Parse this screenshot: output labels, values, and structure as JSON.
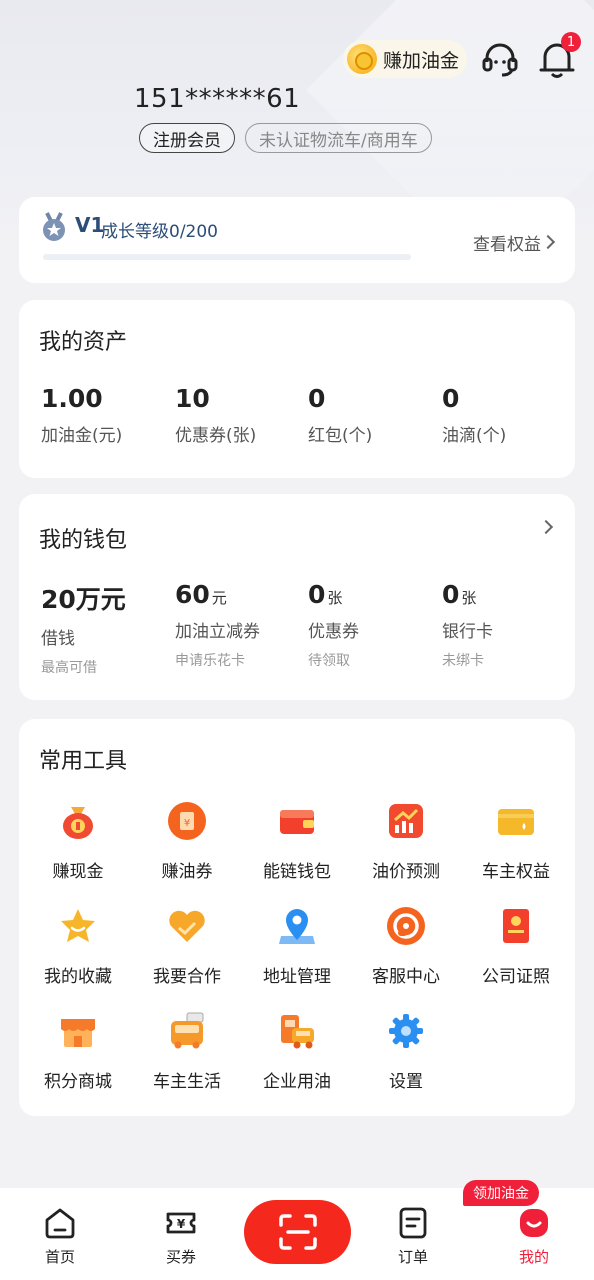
{
  "header": {
    "earn_label": "赚加油金",
    "bell_badge": "1",
    "phone": "151******61",
    "tag_member": "注册会员",
    "tag_vehicle": "未认证物流车/商用车"
  },
  "level": {
    "tier": "V1",
    "progress_text": "成长等级0/200",
    "progress_fraction": 0,
    "view_rights": "查看权益"
  },
  "assets": {
    "title": "我的资产",
    "items": [
      {
        "value": "1.00",
        "label": "加油金(元)"
      },
      {
        "value": "10",
        "label": "优惠券(张)"
      },
      {
        "value": "0",
        "label": "红包(个)"
      },
      {
        "value": "0",
        "label": "油滴(个)"
      }
    ]
  },
  "wallet": {
    "title": "我的钱包",
    "items": [
      {
        "value": "20万元",
        "unit": "",
        "label": "借钱",
        "sub": "最高可借"
      },
      {
        "value": "60",
        "unit": "元",
        "label": "加油立减券",
        "sub": "申请乐花卡"
      },
      {
        "value": "0",
        "unit": "张",
        "label": "优惠券",
        "sub": "待领取"
      },
      {
        "value": "0",
        "unit": "张",
        "label": "银行卡",
        "sub": "未绑卡"
      }
    ]
  },
  "tools": {
    "title": "常用工具",
    "items": [
      {
        "label": "赚现金",
        "icon": "money-bag-icon",
        "color": "#f04a32"
      },
      {
        "label": "赚油券",
        "icon": "coupon-icon",
        "color": "#f5641e"
      },
      {
        "label": "能链钱包",
        "icon": "wallet-icon",
        "color": "#f2402c"
      },
      {
        "label": "油价预测",
        "icon": "chart-icon",
        "color": "#f24a2e"
      },
      {
        "label": "车主权益",
        "icon": "card-icon",
        "color": "#f5b82a"
      },
      {
        "label": "我的收藏",
        "icon": "star-icon",
        "color": "#f7b62a"
      },
      {
        "label": "我要合作",
        "icon": "handshake-icon",
        "color": "#f7a82a"
      },
      {
        "label": "地址管理",
        "icon": "location-icon",
        "color": "#2a8ff0"
      },
      {
        "label": "客服中心",
        "icon": "support-icon",
        "color": "#f5641e"
      },
      {
        "label": "公司证照",
        "icon": "license-icon",
        "color": "#f2402c"
      },
      {
        "label": "积分商城",
        "icon": "shop-icon",
        "color": "#f57a2a"
      },
      {
        "label": "车主生活",
        "icon": "bus-icon",
        "color": "#f59a2a"
      },
      {
        "label": "企业用油",
        "icon": "truck-icon",
        "color": "#f57a2a"
      },
      {
        "label": "设置",
        "icon": "gear-icon",
        "color": "#2a8ff0"
      }
    ]
  },
  "tabbar": {
    "items": [
      {
        "label": "首页",
        "icon": "home-icon"
      },
      {
        "label": "买券",
        "icon": "ticket-icon"
      },
      {
        "label": "订单",
        "icon": "order-icon"
      },
      {
        "label": "我的",
        "icon": "profile-icon"
      }
    ],
    "promo": "领加油金",
    "active_color": "#f0203a"
  }
}
